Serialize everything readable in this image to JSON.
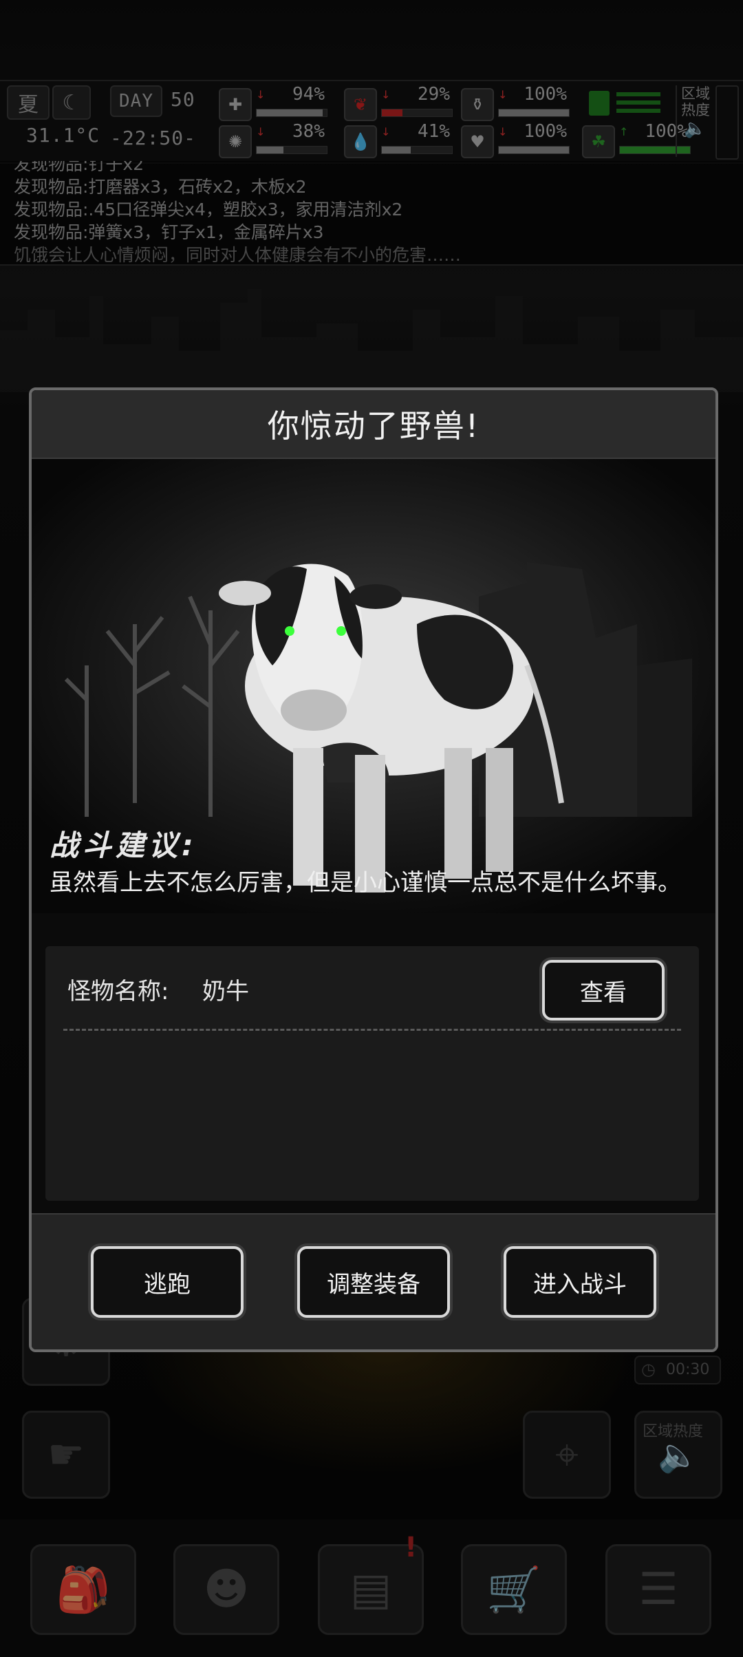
{
  "hud": {
    "season": "夏",
    "day_label": "DAY",
    "day": "50",
    "temperature": "31.1°C",
    "time": "-22:50-",
    "zone_heat_label": "区域热度",
    "stats": [
      {
        "icon": "medkit-icon",
        "glyph": "✚",
        "value": "94%",
        "trend": "↓",
        "fill": 0.94,
        "tone": "gray"
      },
      {
        "icon": "stomach-icon",
        "glyph": "❦",
        "value": "29%",
        "trend": "↓",
        "fill": 0.29,
        "tone": "red"
      },
      {
        "icon": "stamina-icon",
        "glyph": "⚱",
        "value": "100%",
        "trend": "↓",
        "fill": 1.0,
        "tone": "gray"
      },
      {
        "icon": "brain-icon",
        "glyph": "✺",
        "value": "38%",
        "trend": "↓",
        "fill": 0.38,
        "tone": "gray"
      },
      {
        "icon": "water-icon",
        "glyph": "💧",
        "value": "41%",
        "trend": "↓",
        "fill": 0.41,
        "tone": "gray"
      },
      {
        "icon": "heart-icon",
        "glyph": "♥",
        "value": "100%",
        "trend": "↓",
        "fill": 1.0,
        "tone": "gray"
      },
      {
        "icon": "mood-icon",
        "glyph": "☘",
        "value": "100%",
        "trend": "↑",
        "fill": 1.0,
        "tone": "green"
      }
    ]
  },
  "log": [
    "发现物品:钉子x2",
    "发现物品:打磨器x3，石砖x2，木板x2",
    "发现物品:.45口径弹尖x4，塑胶x3，家用清洁剂x2",
    "发现物品:弹簧x3，钉子x1，金属碎片x3",
    "饥饿会让人心情烦闷，同时对人体健康会有不小的危害……"
  ],
  "background": {
    "timer": "00:30",
    "zone_heat_label": "区域热度"
  },
  "modal": {
    "title": "你惊动了野兽!",
    "advice_heading": "战斗建议:",
    "advice_text": "虽然看上去不怎么厉害，但是小心谨慎一点总不是什么坏事。",
    "monster_label": "怪物名称:",
    "monster_name": "奶牛",
    "view_button": "查看",
    "buttons": {
      "flee": "逃跑",
      "adjust": "调整装备",
      "fight": "进入战斗"
    }
  },
  "colors": {
    "accent_red": "#cc2222",
    "accent_green": "#2e9a2e",
    "eye_glow": "#3cff3c"
  }
}
